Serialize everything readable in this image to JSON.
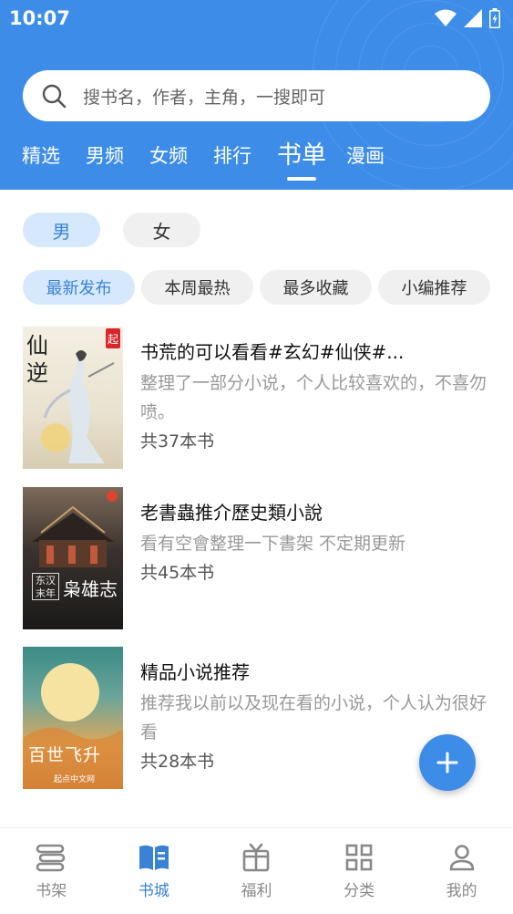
{
  "status_bar": {
    "time": "10:07"
  },
  "search": {
    "placeholder": "搜书名，作者，主角，一搜即可"
  },
  "tabs": [
    {
      "label": "精选"
    },
    {
      "label": "男频"
    },
    {
      "label": "女频"
    },
    {
      "label": "排行"
    },
    {
      "label": "书单",
      "active": true
    },
    {
      "label": "漫画"
    }
  ],
  "gender": {
    "male": "男",
    "female": "女",
    "selected": "男"
  },
  "filters": [
    {
      "label": "最新发布",
      "active": true
    },
    {
      "label": "本周最热"
    },
    {
      "label": "最多收藏"
    },
    {
      "label": "小编推荐"
    }
  ],
  "booklists": [
    {
      "title": "书荒的可以看看#玄幻#仙侠#...",
      "desc": "整理了一部分小说，个人比较喜欢的，不喜勿喷。",
      "count": "共37本书",
      "cover_text": "仙逆",
      "cover_badge": "起"
    },
    {
      "title": "老書蟲推介歷史類小說",
      "desc": "看有空會整理一下書架 不定期更新",
      "count": "共45本书",
      "cover_text": "枭雄志",
      "cover_side": "东汉末年"
    },
    {
      "title": "精品小说推荐",
      "desc": "推荐我以前以及现在看的小说，个人认为很好看",
      "count": "共28本书",
      "cover_text": "百世飞升",
      "cover_footer": "起点中文网"
    }
  ],
  "fab": {
    "icon": "plus-icon"
  },
  "bottom_nav": [
    {
      "label": "书架",
      "icon": "bookshelf-icon"
    },
    {
      "label": "书城",
      "icon": "open-book-icon",
      "active": true
    },
    {
      "label": "福利",
      "icon": "gift-icon"
    },
    {
      "label": "分类",
      "icon": "grid-icon"
    },
    {
      "label": "我的",
      "icon": "person-icon"
    }
  ],
  "colors": {
    "primary": "#3d8de8",
    "active_text": "#3a82d6",
    "active_pill_bg": "#d6e8fb",
    "pill_bg": "#f0f0f0"
  }
}
